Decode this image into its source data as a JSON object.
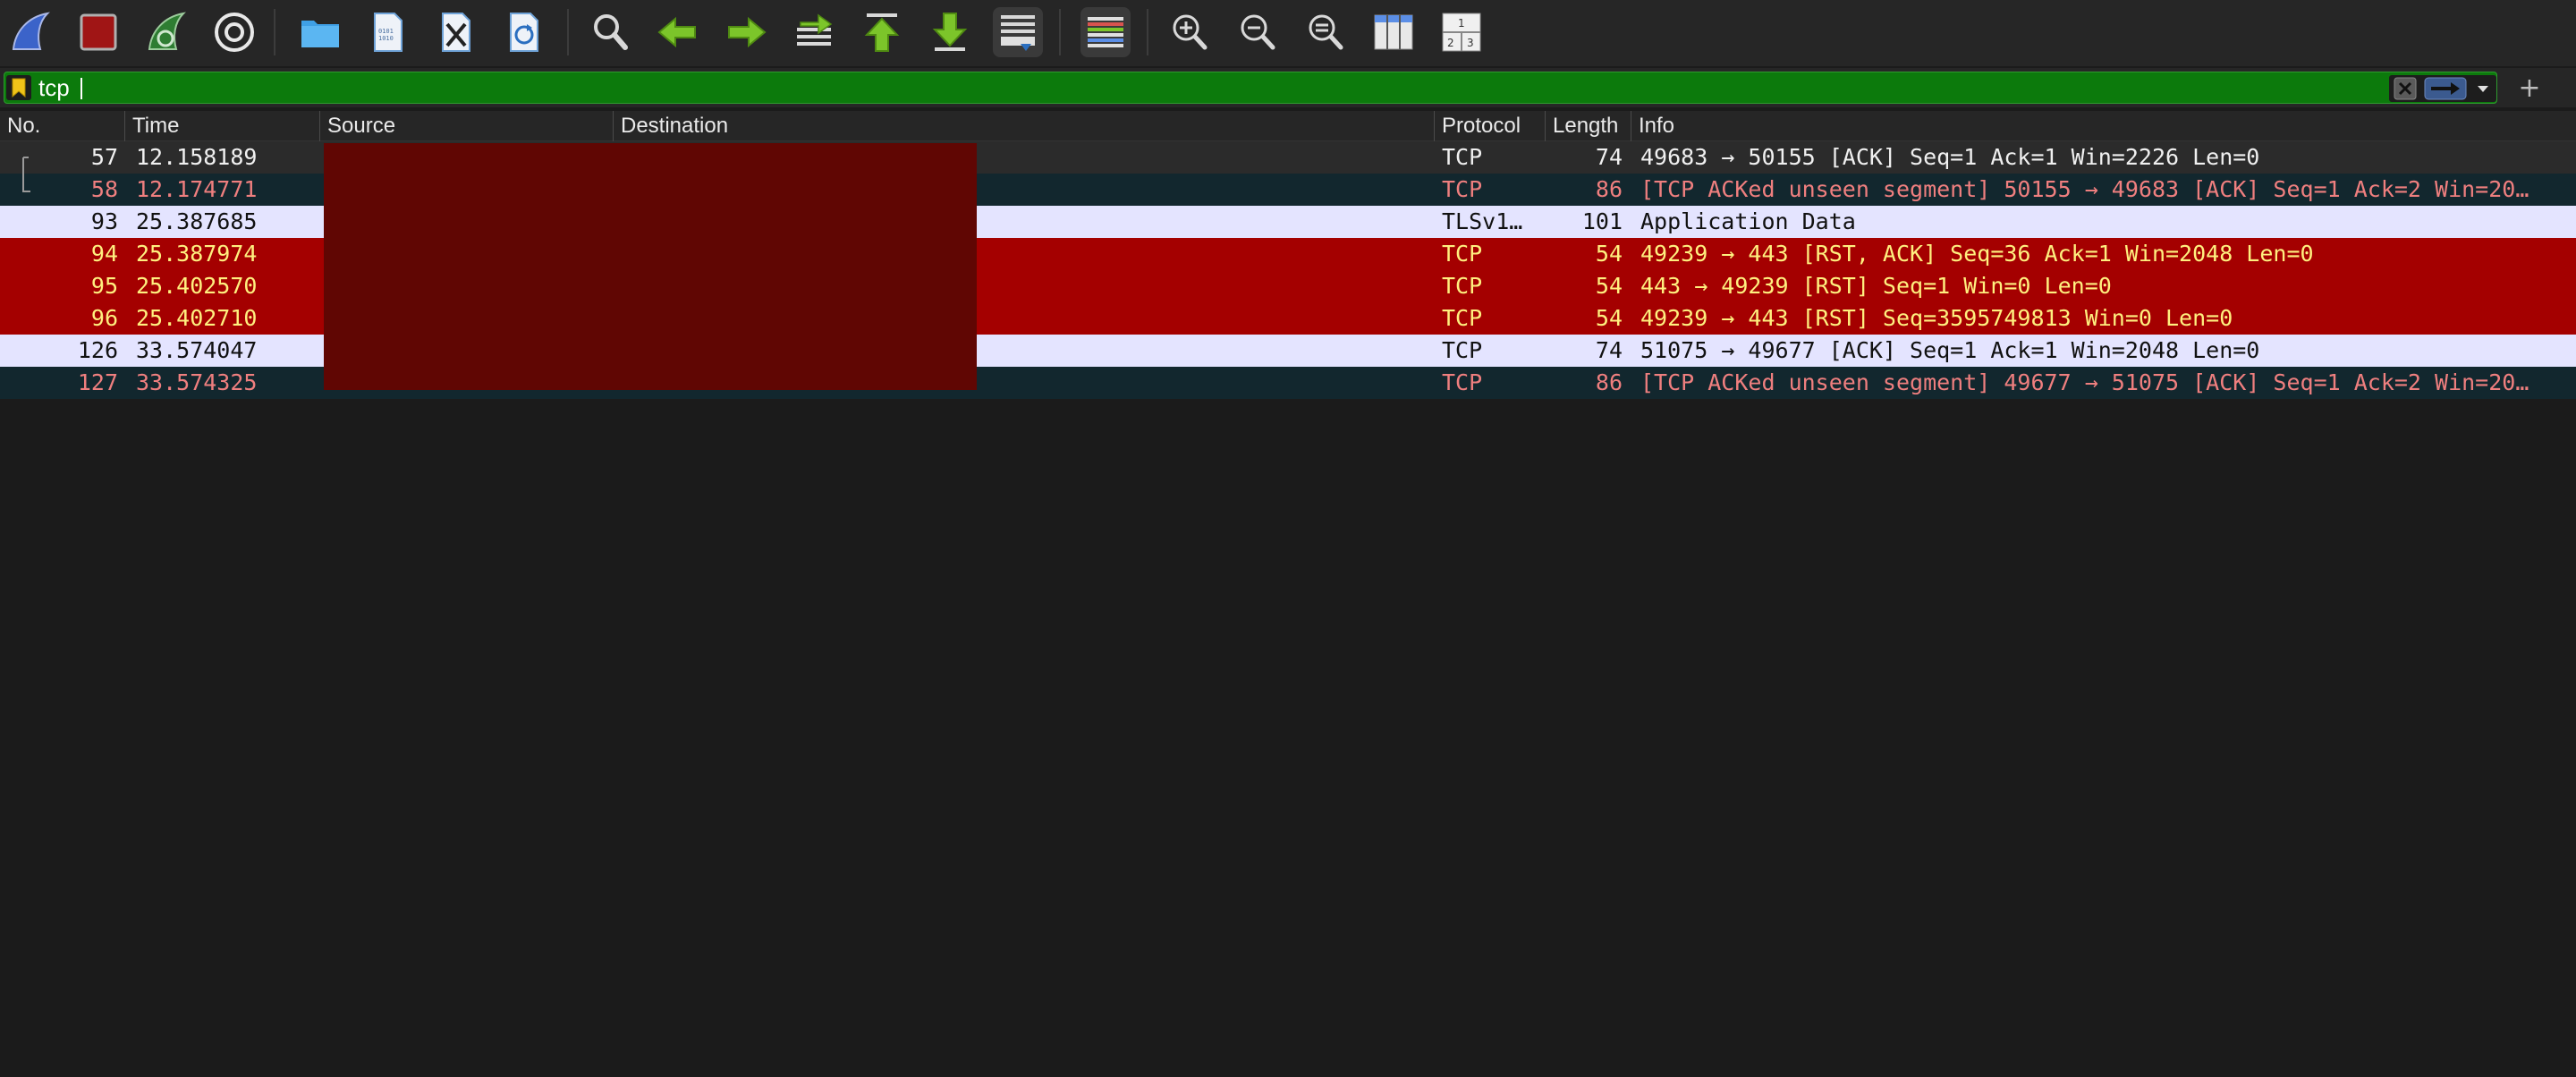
{
  "toolbar": {
    "buttons": [
      {
        "icon": "shark-fin-start-capture-icon"
      },
      {
        "icon": "stop-capture-icon"
      },
      {
        "icon": "restart-capture-icon"
      },
      {
        "icon": "capture-options-gear-icon"
      },
      {
        "icon": "open-file-folder-icon"
      },
      {
        "icon": "save-file-icon"
      },
      {
        "icon": "close-file-icon"
      },
      {
        "icon": "reload-file-icon"
      },
      {
        "icon": "find-packet-icon"
      },
      {
        "icon": "go-back-arrow-icon"
      },
      {
        "icon": "go-forward-arrow-icon"
      },
      {
        "icon": "go-to-packet-icon"
      },
      {
        "icon": "go-to-first-packet-icon"
      },
      {
        "icon": "go-to-last-packet-icon"
      },
      {
        "icon": "auto-scroll-icon"
      },
      {
        "icon": "colorize-packet-list-icon"
      },
      {
        "icon": "zoom-in-icon"
      },
      {
        "icon": "zoom-out-icon"
      },
      {
        "icon": "normal-size-icon"
      },
      {
        "icon": "resize-columns-icon"
      },
      {
        "icon": "layout-panes-icon"
      }
    ]
  },
  "filter": {
    "value": "tcp",
    "background": "#0c7a0c"
  },
  "columns": [
    "No.",
    "Time",
    "Source",
    "Destination",
    "Protocol",
    "Length",
    "Info"
  ],
  "colors": {
    "row_default_bg": "#2b2b2b",
    "row_default_fg": "#f0f0f0",
    "row_ack_unseen_bg": "#12272e",
    "row_ack_unseen_fg": "#ef7f7f",
    "row_tls_bg": "#e4e4ff",
    "row_tls_fg": "#111111",
    "row_rst_bg": "#a40000",
    "row_rst_fg": "#fff07f",
    "redaction": "#600603"
  },
  "packets": [
    {
      "no": "57",
      "time": "12.158189",
      "protocol": "TCP",
      "length": "74",
      "info": "49683 → 50155 [ACK] Seq=1 Ack=1 Win=2226 Len=0",
      "style": "default"
    },
    {
      "no": "58",
      "time": "12.174771",
      "protocol": "TCP",
      "length": "86",
      "info": "[TCP ACKed unseen segment] 50155 → 49683 [ACK] Seq=1 Ack=2 Win=20…",
      "style": "ack_unseen"
    },
    {
      "no": "93",
      "time": "25.387685",
      "protocol": "TLSv1…",
      "length": "101",
      "info": "Application Data",
      "style": "tls"
    },
    {
      "no": "94",
      "time": "25.387974",
      "protocol": "TCP",
      "length": "54",
      "info": "49239 → 443 [RST, ACK] Seq=36 Ack=1 Win=2048 Len=0",
      "style": "rst"
    },
    {
      "no": "95",
      "time": "25.402570",
      "protocol": "TCP",
      "length": "54",
      "info": "443 → 49239 [RST] Seq=1 Win=0 Len=0",
      "style": "rst"
    },
    {
      "no": "96",
      "time": "25.402710",
      "protocol": "TCP",
      "length": "54",
      "info": "49239 → 443 [RST] Seq=3595749813 Win=0 Len=0",
      "style": "rst"
    },
    {
      "no": "126",
      "time": "33.574047",
      "protocol": "TCP",
      "length": "74",
      "info": "51075 → 49677 [ACK] Seq=1 Ack=1 Win=2048 Len=0",
      "style": "tls"
    },
    {
      "no": "127",
      "time": "33.574325",
      "protocol": "TCP",
      "length": "86",
      "info": "[TCP ACKed unseen segment] 49677 → 51075 [ACK] Seq=1 Ack=2 Win=20…",
      "style": "ack_unseen"
    }
  ]
}
